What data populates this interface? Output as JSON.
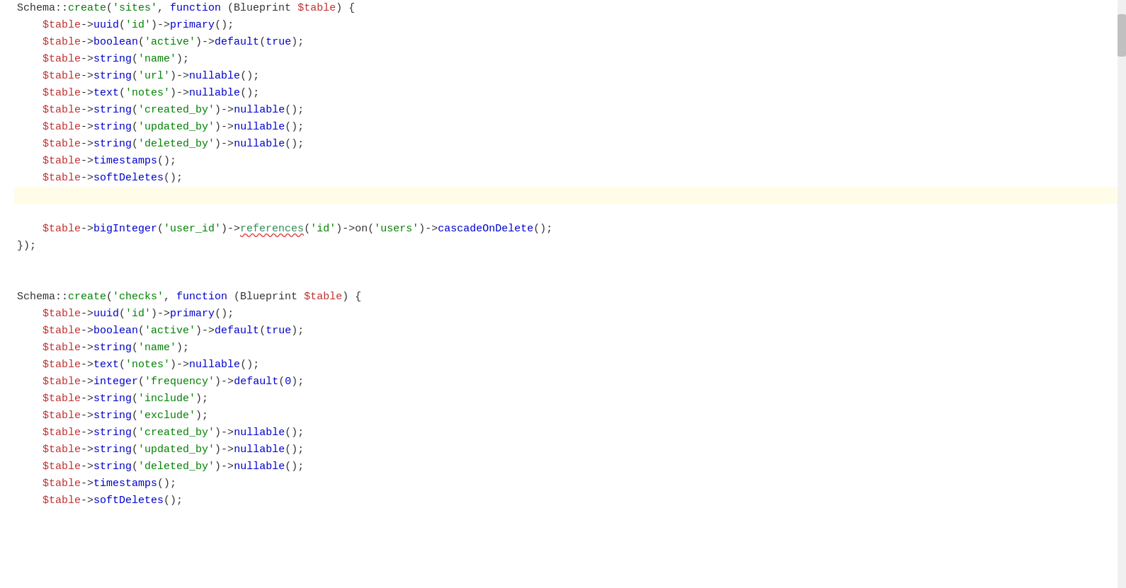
{
  "editor": {
    "lines": [
      {
        "id": 1,
        "highlighted": false,
        "content": [
          {
            "type": "plain",
            "text": "Schema::"
          },
          {
            "type": "fn",
            "text": "create"
          },
          {
            "type": "plain",
            "text": "("
          },
          {
            "type": "str",
            "text": "'sites'"
          },
          {
            "type": "plain",
            "text": ", "
          },
          {
            "type": "kw",
            "text": "function"
          },
          {
            "type": "plain",
            "text": " (Blueprint "
          },
          {
            "type": "var",
            "text": "$table"
          },
          {
            "type": "plain",
            "text": ") {"
          }
        ]
      },
      {
        "id": 2,
        "highlighted": false,
        "indent": 2,
        "content": [
          {
            "type": "var",
            "text": "$table"
          },
          {
            "type": "plain",
            "text": "->"
          },
          {
            "type": "method",
            "text": "uuid"
          },
          {
            "type": "plain",
            "text": "("
          },
          {
            "type": "str",
            "text": "'id'"
          },
          {
            "type": "plain",
            "text": ")->"
          },
          {
            "type": "method",
            "text": "primary"
          },
          {
            "type": "plain",
            "text": "();"
          }
        ]
      },
      {
        "id": 3,
        "highlighted": false,
        "indent": 2,
        "content": [
          {
            "type": "var",
            "text": "$table"
          },
          {
            "type": "plain",
            "text": "->"
          },
          {
            "type": "method",
            "text": "boolean"
          },
          {
            "type": "plain",
            "text": "("
          },
          {
            "type": "str",
            "text": "'active'"
          },
          {
            "type": "plain",
            "text": ")->"
          },
          {
            "type": "method",
            "text": "default"
          },
          {
            "type": "plain",
            "text": "("
          },
          {
            "type": "kw",
            "text": "true"
          },
          {
            "type": "plain",
            "text": ");"
          }
        ]
      },
      {
        "id": 4,
        "highlighted": false,
        "indent": 2,
        "content": [
          {
            "type": "var",
            "text": "$table"
          },
          {
            "type": "plain",
            "text": "->"
          },
          {
            "type": "method",
            "text": "string"
          },
          {
            "type": "plain",
            "text": "("
          },
          {
            "type": "str",
            "text": "'name'"
          },
          {
            "type": "plain",
            "text": ");"
          }
        ]
      },
      {
        "id": 5,
        "highlighted": false,
        "indent": 2,
        "content": [
          {
            "type": "var",
            "text": "$table"
          },
          {
            "type": "plain",
            "text": "->"
          },
          {
            "type": "method",
            "text": "string"
          },
          {
            "type": "plain",
            "text": "("
          },
          {
            "type": "str",
            "text": "'url'"
          },
          {
            "type": "plain",
            "text": ")->"
          },
          {
            "type": "method",
            "text": "nullable"
          },
          {
            "type": "plain",
            "text": "();"
          }
        ]
      },
      {
        "id": 6,
        "highlighted": false,
        "indent": 2,
        "content": [
          {
            "type": "var",
            "text": "$table"
          },
          {
            "type": "plain",
            "text": "->"
          },
          {
            "type": "method",
            "text": "text"
          },
          {
            "type": "plain",
            "text": "("
          },
          {
            "type": "str",
            "text": "'notes'"
          },
          {
            "type": "plain",
            "text": ")->"
          },
          {
            "type": "method",
            "text": "nullable"
          },
          {
            "type": "plain",
            "text": "();"
          }
        ]
      },
      {
        "id": 7,
        "highlighted": false,
        "indent": 2,
        "content": [
          {
            "type": "var",
            "text": "$table"
          },
          {
            "type": "plain",
            "text": "->"
          },
          {
            "type": "method",
            "text": "string"
          },
          {
            "type": "plain",
            "text": "("
          },
          {
            "type": "str",
            "text": "'created_by'"
          },
          {
            "type": "plain",
            "text": ")->"
          },
          {
            "type": "method",
            "text": "nullable"
          },
          {
            "type": "plain",
            "text": "();"
          }
        ]
      },
      {
        "id": 8,
        "highlighted": false,
        "indent": 2,
        "content": [
          {
            "type": "var",
            "text": "$table"
          },
          {
            "type": "plain",
            "text": "->"
          },
          {
            "type": "method",
            "text": "string"
          },
          {
            "type": "plain",
            "text": "("
          },
          {
            "type": "str",
            "text": "'updated_by'"
          },
          {
            "type": "plain",
            "text": ")->"
          },
          {
            "type": "method",
            "text": "nullable"
          },
          {
            "type": "plain",
            "text": "();"
          }
        ]
      },
      {
        "id": 9,
        "highlighted": false,
        "indent": 2,
        "content": [
          {
            "type": "var",
            "text": "$table"
          },
          {
            "type": "plain",
            "text": "->"
          },
          {
            "type": "method",
            "text": "string"
          },
          {
            "type": "plain",
            "text": "("
          },
          {
            "type": "str",
            "text": "'deleted_by'"
          },
          {
            "type": "plain",
            "text": ")->"
          },
          {
            "type": "method",
            "text": "nullable"
          },
          {
            "type": "plain",
            "text": "();"
          }
        ]
      },
      {
        "id": 10,
        "highlighted": false,
        "indent": 2,
        "content": [
          {
            "type": "var",
            "text": "$table"
          },
          {
            "type": "plain",
            "text": "->"
          },
          {
            "type": "method",
            "text": "timestamps"
          },
          {
            "type": "plain",
            "text": "();"
          }
        ]
      },
      {
        "id": 11,
        "highlighted": false,
        "indent": 2,
        "content": [
          {
            "type": "var",
            "text": "$table"
          },
          {
            "type": "plain",
            "text": "->"
          },
          {
            "type": "method",
            "text": "softDeletes"
          },
          {
            "type": "plain",
            "text": "();"
          }
        ]
      },
      {
        "id": 12,
        "highlighted": true,
        "content": []
      },
      {
        "id": 13,
        "highlighted": false,
        "indent": 2,
        "content": []
      },
      {
        "id": 14,
        "highlighted": false,
        "indent": 2,
        "content": [
          {
            "type": "var",
            "text": "$table"
          },
          {
            "type": "plain",
            "text": "->"
          },
          {
            "type": "method",
            "text": "bigInteger"
          },
          {
            "type": "plain",
            "text": "("
          },
          {
            "type": "str",
            "text": "'user_id'"
          },
          {
            "type": "plain",
            "text": ")->"
          },
          {
            "type": "ref",
            "text": "references"
          },
          {
            "type": "plain",
            "text": "("
          },
          {
            "type": "str",
            "text": "'id'"
          },
          {
            "type": "plain",
            "text": ")->on("
          },
          {
            "type": "str",
            "text": "'users'"
          },
          {
            "type": "plain",
            "text": ")->"
          },
          {
            "type": "method",
            "text": "cascadeOnDelete"
          },
          {
            "type": "plain",
            "text": "();"
          }
        ]
      },
      {
        "id": 15,
        "highlighted": false,
        "content": [
          {
            "type": "plain",
            "text": "});"
          }
        ]
      },
      {
        "id": 16,
        "highlighted": false,
        "content": []
      },
      {
        "id": 17,
        "highlighted": false,
        "content": []
      },
      {
        "id": 18,
        "highlighted": false,
        "content": [
          {
            "type": "plain",
            "text": "Schema::"
          },
          {
            "type": "fn",
            "text": "create"
          },
          {
            "type": "plain",
            "text": "("
          },
          {
            "type": "str",
            "text": "'checks'"
          },
          {
            "type": "plain",
            "text": ", "
          },
          {
            "type": "kw",
            "text": "function"
          },
          {
            "type": "plain",
            "text": " (Blueprint "
          },
          {
            "type": "var",
            "text": "$table"
          },
          {
            "type": "plain",
            "text": ") {"
          }
        ]
      },
      {
        "id": 19,
        "highlighted": false,
        "indent": 2,
        "content": [
          {
            "type": "var",
            "text": "$table"
          },
          {
            "type": "plain",
            "text": "->"
          },
          {
            "type": "method",
            "text": "uuid"
          },
          {
            "type": "plain",
            "text": "("
          },
          {
            "type": "str",
            "text": "'id'"
          },
          {
            "type": "plain",
            "text": ")->"
          },
          {
            "type": "method",
            "text": "primary"
          },
          {
            "type": "plain",
            "text": "();"
          }
        ]
      },
      {
        "id": 20,
        "highlighted": false,
        "indent": 2,
        "content": [
          {
            "type": "var",
            "text": "$table"
          },
          {
            "type": "plain",
            "text": "->"
          },
          {
            "type": "method",
            "text": "boolean"
          },
          {
            "type": "plain",
            "text": "("
          },
          {
            "type": "str",
            "text": "'active'"
          },
          {
            "type": "plain",
            "text": ")->"
          },
          {
            "type": "method",
            "text": "default"
          },
          {
            "type": "plain",
            "text": "("
          },
          {
            "type": "kw",
            "text": "true"
          },
          {
            "type": "plain",
            "text": ");"
          }
        ]
      },
      {
        "id": 21,
        "highlighted": false,
        "indent": 2,
        "content": [
          {
            "type": "var",
            "text": "$table"
          },
          {
            "type": "plain",
            "text": "->"
          },
          {
            "type": "method",
            "text": "string"
          },
          {
            "type": "plain",
            "text": "("
          },
          {
            "type": "str",
            "text": "'name'"
          },
          {
            "type": "plain",
            "text": ");"
          }
        ]
      },
      {
        "id": 22,
        "highlighted": false,
        "indent": 2,
        "content": [
          {
            "type": "var",
            "text": "$table"
          },
          {
            "type": "plain",
            "text": "->"
          },
          {
            "type": "method",
            "text": "text"
          },
          {
            "type": "plain",
            "text": "("
          },
          {
            "type": "str",
            "text": "'notes'"
          },
          {
            "type": "plain",
            "text": ")->"
          },
          {
            "type": "method",
            "text": "nullable"
          },
          {
            "type": "plain",
            "text": "();"
          }
        ]
      },
      {
        "id": 23,
        "highlighted": false,
        "indent": 2,
        "content": [
          {
            "type": "var",
            "text": "$table"
          },
          {
            "type": "plain",
            "text": "->"
          },
          {
            "type": "method",
            "text": "integer"
          },
          {
            "type": "plain",
            "text": "("
          },
          {
            "type": "str",
            "text": "'frequency'"
          },
          {
            "type": "plain",
            "text": ")->"
          },
          {
            "type": "method",
            "text": "default"
          },
          {
            "type": "plain",
            "text": "("
          },
          {
            "type": "num",
            "text": "0"
          },
          {
            "type": "plain",
            "text": ");"
          }
        ]
      },
      {
        "id": 24,
        "highlighted": false,
        "indent": 2,
        "content": [
          {
            "type": "var",
            "text": "$table"
          },
          {
            "type": "plain",
            "text": "->"
          },
          {
            "type": "method",
            "text": "string"
          },
          {
            "type": "plain",
            "text": "("
          },
          {
            "type": "str",
            "text": "'include'"
          },
          {
            "type": "plain",
            "text": ");"
          }
        ]
      },
      {
        "id": 25,
        "highlighted": false,
        "indent": 2,
        "content": [
          {
            "type": "var",
            "text": "$table"
          },
          {
            "type": "plain",
            "text": "->"
          },
          {
            "type": "method",
            "text": "string"
          },
          {
            "type": "plain",
            "text": "("
          },
          {
            "type": "str",
            "text": "'exclude'"
          },
          {
            "type": "plain",
            "text": ");"
          }
        ]
      },
      {
        "id": 26,
        "highlighted": false,
        "indent": 2,
        "content": [
          {
            "type": "var",
            "text": "$table"
          },
          {
            "type": "plain",
            "text": "->"
          },
          {
            "type": "method",
            "text": "string"
          },
          {
            "type": "plain",
            "text": "("
          },
          {
            "type": "str",
            "text": "'created_by'"
          },
          {
            "type": "plain",
            "text": ")->"
          },
          {
            "type": "method",
            "text": "nullable"
          },
          {
            "type": "plain",
            "text": "();"
          }
        ]
      },
      {
        "id": 27,
        "highlighted": false,
        "indent": 2,
        "content": [
          {
            "type": "var",
            "text": "$table"
          },
          {
            "type": "plain",
            "text": "->"
          },
          {
            "type": "method",
            "text": "string"
          },
          {
            "type": "plain",
            "text": "("
          },
          {
            "type": "str",
            "text": "'updated_by'"
          },
          {
            "type": "plain",
            "text": ")->"
          },
          {
            "type": "method",
            "text": "nullable"
          },
          {
            "type": "plain",
            "text": "();"
          }
        ]
      },
      {
        "id": 28,
        "highlighted": false,
        "indent": 2,
        "content": [
          {
            "type": "var",
            "text": "$table"
          },
          {
            "type": "plain",
            "text": "->"
          },
          {
            "type": "method",
            "text": "string"
          },
          {
            "type": "plain",
            "text": "("
          },
          {
            "type": "str",
            "text": "'deleted_by'"
          },
          {
            "type": "plain",
            "text": ")->"
          },
          {
            "type": "method",
            "text": "nullable"
          },
          {
            "type": "plain",
            "text": "();"
          }
        ]
      },
      {
        "id": 29,
        "highlighted": false,
        "indent": 2,
        "content": [
          {
            "type": "var",
            "text": "$table"
          },
          {
            "type": "plain",
            "text": "->"
          },
          {
            "type": "method",
            "text": "timestamps"
          },
          {
            "type": "plain",
            "text": "();"
          }
        ]
      },
      {
        "id": 30,
        "highlighted": false,
        "indent": 2,
        "content": [
          {
            "type": "var",
            "text": "$table"
          },
          {
            "type": "plain",
            "text": "->"
          },
          {
            "type": "method",
            "text": "softDeletes"
          },
          {
            "type": "plain",
            "text": "();"
          }
        ]
      }
    ]
  }
}
